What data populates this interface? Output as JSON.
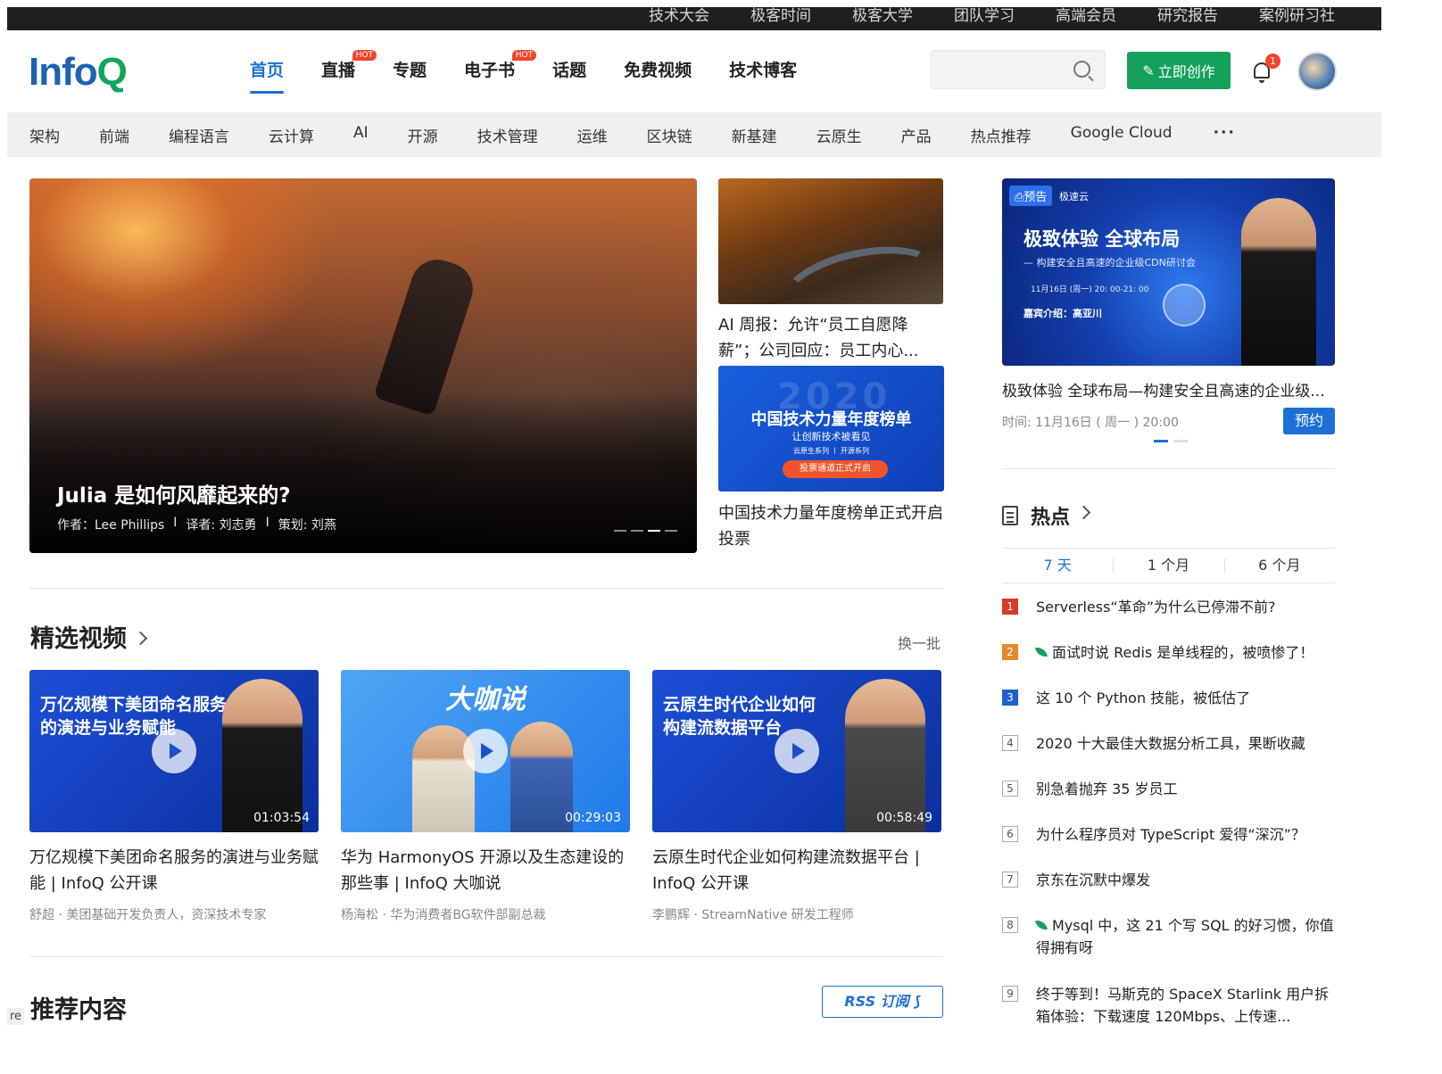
{
  "topbar": {
    "links": [
      "技术大会",
      "极客时间",
      "极客大学",
      "团队学习",
      "高端会员",
      "研究报告",
      "案例研习社"
    ]
  },
  "header": {
    "logo_main": "InfoQ",
    "nav": [
      {
        "label": "首页",
        "hot": false,
        "active": true
      },
      {
        "label": "直播",
        "hot": true
      },
      {
        "label": "专题",
        "hot": false
      },
      {
        "label": "电子书",
        "hot": true
      },
      {
        "label": "话题",
        "hot": false
      },
      {
        "label": "免费视频",
        "hot": false
      },
      {
        "label": "技术博客",
        "hot": false
      }
    ],
    "hot_label": "HOT",
    "search_placeholder": "",
    "create_label": "立即创作",
    "notification_count": "1"
  },
  "categories": [
    "架构",
    "前端",
    "编程语言",
    "云计算",
    "AI",
    "开源",
    "技术管理",
    "运维",
    "区块链",
    "新基建",
    "云原生",
    "产品",
    "热点推荐",
    "Google Cloud"
  ],
  "categories_more": "···",
  "hero": {
    "title": "Julia 是如何风靡起来的?",
    "author": "作者：Lee Phillips",
    "translator": "译者: 刘志勇",
    "editor": "策划: 刘燕",
    "sep": "I"
  },
  "side_articles": [
    {
      "title": "AI 周报：允许“员工自愿降薪”；公司回应：员工内心..."
    },
    {
      "title": "中国技术力量年度榜单正式开启投票",
      "img_title": "中国技术力量年度榜单",
      "img_sub": "让创新技术被看见",
      "img_sub2": "云原生系列 丨 开源系列",
      "img_btn": "投票通道正式开启",
      "img_year": "2020"
    }
  ],
  "live": {
    "tag": "预告",
    "tag2": "极速云",
    "banner_h1": "极致体验  全球布局",
    "banner_h2": "— 构建安全且高速的企业级CDN研讨会",
    "banner_time": "11月16日 (周一) 20: 00-21: 00",
    "banner_guest": "嘉宾介绍：高亚川",
    "title": "极致体验 全球布局—构建安全且高速的企业级...",
    "meta": "时间: 11月16日 ( 周一 ) 20:00",
    "reserve_label": "预约"
  },
  "videos_section": {
    "title": "精选视频",
    "refresh": "换一批"
  },
  "videos": [
    {
      "thumb_text": "万亿规模下美团命名服务\n的演进与业务赋能",
      "duration": "01:03:54",
      "title": "万亿规模下美团命名服务的演进与业务赋能 | InfoQ 公开课",
      "meta": "舒超 · 美团基础开发负责人，资深技术专家"
    },
    {
      "thumb_text": "大咖说",
      "duration": "00:29:03",
      "title": "华为 HarmonyOS 开源以及生态建设的那些事 | InfoQ 大咖说",
      "meta": "杨海松 · 华为消费者BG软件部副总裁"
    },
    {
      "thumb_text": "云原生时代企业如何\n构建流数据平台",
      "duration": "00:58:49",
      "title": "云原生时代企业如何构建流数据平台 | InfoQ 公开课",
      "meta": "李鹏辉 · StreamNative 研发工程师"
    }
  ],
  "recommend": {
    "title": "推荐内容",
    "rss_label": "RSS 订阅"
  },
  "hot": {
    "title": "热点",
    "tabs": [
      "7 天",
      "1 个月",
      "6 个月"
    ],
    "items": [
      {
        "rank": "1",
        "text": "Serverless“革命”为什么已停滞不前?",
        "leaf": false
      },
      {
        "rank": "2",
        "text": "面试时说 Redis 是单线程的，被喷惨了！",
        "leaf": true
      },
      {
        "rank": "3",
        "text": "这 10 个 Python 技能，被低估了",
        "leaf": false
      },
      {
        "rank": "4",
        "text": "2020 十大最佳大数据分析工具，果断收藏",
        "leaf": false
      },
      {
        "rank": "5",
        "text": "别急着抛弃 35 岁员工",
        "leaf": false
      },
      {
        "rank": "6",
        "text": "为什么程序员对 TypeScript 爱得“深沉”？",
        "leaf": false
      },
      {
        "rank": "7",
        "text": "京东在沉默中爆发",
        "leaf": false
      },
      {
        "rank": "8",
        "text": "Mysql 中，这 21 个写 SQL 的好习惯，你值得拥有呀",
        "leaf": true
      },
      {
        "rank": "9",
        "text": "终于等到！马斯克的 SpaceX Starlink 用户拆箱体验：下载速度 120Mbps、上传速...",
        "leaf": false
      }
    ]
  },
  "edge_text": "re"
}
